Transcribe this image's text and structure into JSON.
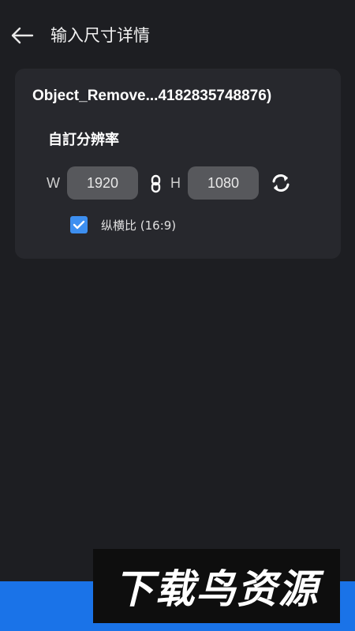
{
  "header": {
    "title": "输入尺寸详情",
    "back_icon": "arrow-left-icon"
  },
  "card": {
    "file_name": "Object_Remove...4182835748876)",
    "section_title": "自訂分辨率",
    "width_label": "W",
    "width_value": "1920",
    "height_label": "H",
    "height_value": "1080",
    "link_icon": "link-icon",
    "swap_icon": "swap-icon",
    "aspect_ratio": {
      "checked": true,
      "label": "纵横比 (16:9)"
    }
  },
  "watermark": {
    "text": "下载鸟资源"
  },
  "colors": {
    "background": "#1d1e22",
    "card": "#27282d",
    "input": "#57585c",
    "checkbox": "#3d8ff0",
    "bottom_bar": "#1a73e8"
  }
}
